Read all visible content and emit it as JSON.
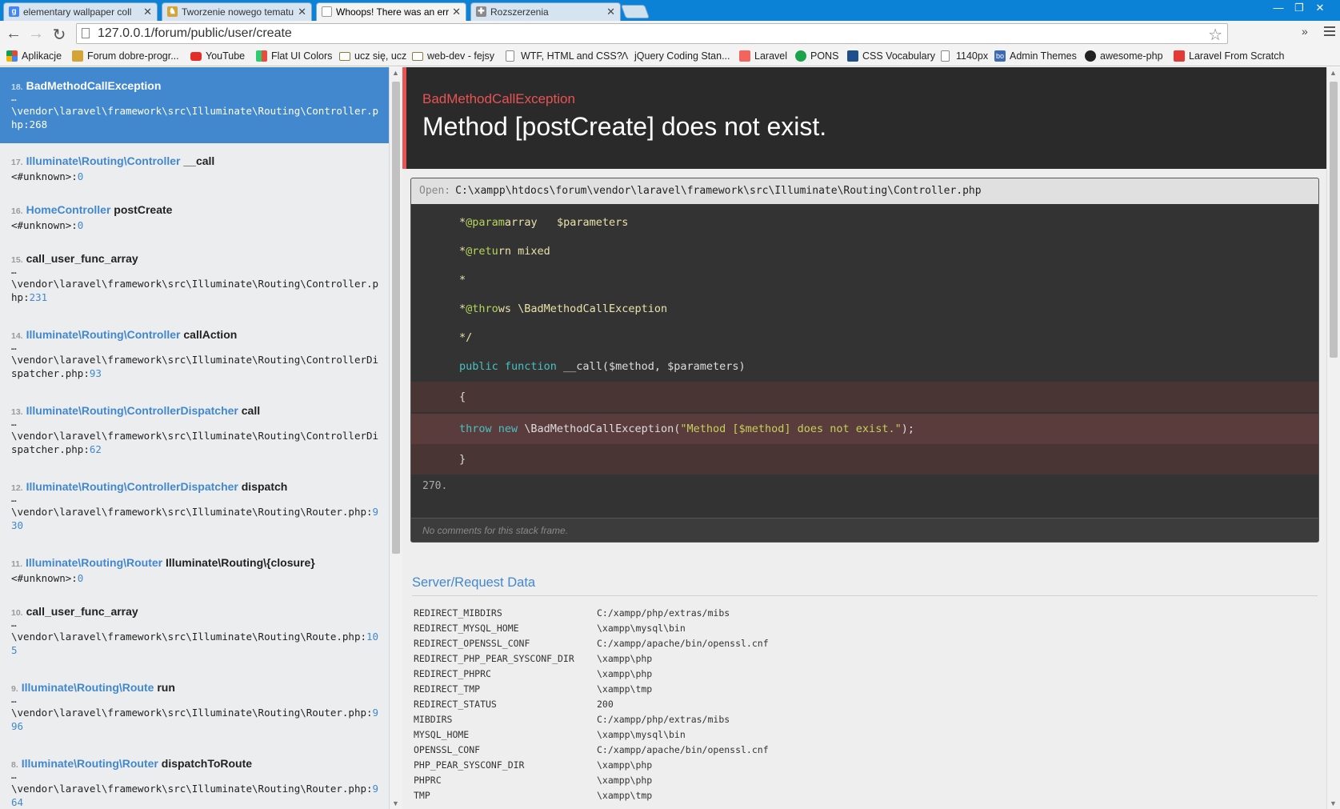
{
  "browser": {
    "tabs": [
      {
        "title": "elementary wallpaper coll",
        "active": false,
        "icon": "google-icon",
        "icon_letter": "g",
        "icon_color": "#4285f4"
      },
      {
        "title": "Tworzenie nowego tematu",
        "active": false,
        "icon": "forum-icon",
        "icon_letter": "♞",
        "icon_color": "#d4a437"
      },
      {
        "title": "Whoops! There was an err",
        "active": true,
        "icon": "page-icon",
        "icon_letter": "",
        "icon_color": "#ffffff"
      },
      {
        "title": "Rozszerzenia",
        "active": false,
        "icon": "puzzle-icon",
        "icon_letter": "✚",
        "icon_color": "#8a8a8a"
      }
    ],
    "url": "127.0.0.1/forum/public/user/create",
    "bookmarks": [
      {
        "label": "Aplikacje",
        "icon": "apps-icon",
        "color": "#e04a3a"
      },
      {
        "label": "Forum dobre-progr...",
        "icon": "forum-icon",
        "color": "#d4a437"
      },
      {
        "label": "YouTube",
        "icon": "youtube-icon",
        "color": "#e52d27"
      },
      {
        "label": "Flat UI Colors",
        "icon": "flatui-icon",
        "color": "#2ecc71"
      },
      {
        "label": "ucz się, ucz",
        "icon": "folder-icon",
        "color": "#f0c060"
      },
      {
        "label": "web-dev - fejsy",
        "icon": "folder-icon",
        "color": "#f0c060"
      },
      {
        "label": "WTF, HTML and CSS?",
        "icon": "page-icon",
        "color": "#ffffff"
      },
      {
        "label": "jQuery Coding Stan...",
        "icon": "jquery-icon",
        "color": "#444444"
      },
      {
        "label": "Laravel",
        "icon": "laravel-icon",
        "color": "#f4645f"
      },
      {
        "label": "PONS",
        "icon": "pons-icon",
        "color": "#1aa34a"
      },
      {
        "label": "CSS Vocabulary",
        "icon": "css-icon",
        "color": "#1f4e8c"
      },
      {
        "label": "1140px",
        "icon": "page-icon",
        "color": "#ffffff"
      },
      {
        "label": "Admin Themes",
        "icon": "bo-icon",
        "color": "#3d6ab4"
      },
      {
        "label": "awesome-php",
        "icon": "github-icon",
        "color": "#222222"
      },
      {
        "label": "Laravel From Scratch",
        "icon": "laracasts-icon",
        "color": "#e53935"
      }
    ]
  },
  "frames": [
    {
      "index": "18.",
      "class": "BadMethodCallException",
      "method": "",
      "dots": "…",
      "file": "\\vendor\\laravel\\framework\\src\\Illuminate\\Routing\\Controller.php",
      "line": "268",
      "active": true
    },
    {
      "index": "17.",
      "class": "Illuminate\\Routing\\Controller",
      "method": "__call",
      "dots": "",
      "file": "<#unknown>",
      "line": "0",
      "active": false
    },
    {
      "index": "16.",
      "class": "HomeController",
      "method": "postCreate",
      "dots": "",
      "file": "<#unknown>",
      "line": "0",
      "active": false
    },
    {
      "index": "15.",
      "class": "",
      "method": "call_user_func_array",
      "dots": "…",
      "file": "\\vendor\\laravel\\framework\\src\\Illuminate\\Routing\\Controller.php",
      "line": "231",
      "active": false
    },
    {
      "index": "14.",
      "class": "Illuminate\\Routing\\Controller",
      "method": "callAction",
      "dots": "…",
      "file": "\\vendor\\laravel\\framework\\src\\Illuminate\\Routing\\ControllerDispatcher.php",
      "line": "93",
      "active": false
    },
    {
      "index": "13.",
      "class": "Illuminate\\Routing\\ControllerDispatcher",
      "method": "call",
      "dots": "…",
      "file": "\\vendor\\laravel\\framework\\src\\Illuminate\\Routing\\ControllerDispatcher.php",
      "line": "62",
      "active": false
    },
    {
      "index": "12.",
      "class": "Illuminate\\Routing\\ControllerDispatcher",
      "method": "dispatch",
      "dots": "…",
      "file": "\\vendor\\laravel\\framework\\src\\Illuminate\\Routing\\Router.php",
      "line": "930",
      "active": false
    },
    {
      "index": "11.",
      "class": "Illuminate\\Routing\\Router",
      "method": "Illuminate\\Routing\\{closure}",
      "dots": "",
      "file": "<#unknown>",
      "line": "0",
      "active": false
    },
    {
      "index": "10.",
      "class": "",
      "method": "call_user_func_array",
      "dots": "…",
      "file": "\\vendor\\laravel\\framework\\src\\Illuminate\\Routing\\Route.php",
      "line": "105",
      "active": false
    },
    {
      "index": "9.",
      "class": "Illuminate\\Routing\\Route",
      "method": "run",
      "dots": "…",
      "file": "\\vendor\\laravel\\framework\\src\\Illuminate\\Routing\\Router.php",
      "line": "996",
      "active": false
    },
    {
      "index": "8.",
      "class": "Illuminate\\Routing\\Router",
      "method": "dispatchToRoute",
      "dots": "…",
      "file": "\\vendor\\laravel\\framework\\src\\Illuminate\\Routing\\Router.php",
      "line": "964",
      "active": false
    }
  ],
  "exception": {
    "class": "BadMethodCallException",
    "message": "Method [postCreate] does not exist."
  },
  "code": {
    "open_label": "Open:",
    "path": "C:\\xampp\\htdocs\\forum\\vendor\\laravel\\framework\\src\\Illuminate\\Routing\\Controller.php",
    "line_number": "270.",
    "comments": "No comments for this stack frame."
  },
  "server_data": {
    "title": "Server/Request Data",
    "rows": [
      {
        "key": "REDIRECT_MIBDIRS",
        "value": "C:/xampp/php/extras/mibs"
      },
      {
        "key": "REDIRECT_MYSQL_HOME",
        "value": "\\xampp\\mysql\\bin"
      },
      {
        "key": "REDIRECT_OPENSSL_CONF",
        "value": "C:/xampp/apache/bin/openssl.cnf"
      },
      {
        "key": "REDIRECT_PHP_PEAR_SYSCONF_DIR",
        "value": "\\xampp\\php"
      },
      {
        "key": "REDIRECT_PHPRC",
        "value": "\\xampp\\php"
      },
      {
        "key": "REDIRECT_TMP",
        "value": "\\xampp\\tmp"
      },
      {
        "key": "REDIRECT_STATUS",
        "value": "200"
      },
      {
        "key": "MIBDIRS",
        "value": "C:/xampp/php/extras/mibs"
      },
      {
        "key": "MYSQL_HOME",
        "value": "\\xampp\\mysql\\bin"
      },
      {
        "key": "OPENSSL_CONF",
        "value": "C:/xampp/apache/bin/openssl.cnf"
      },
      {
        "key": "PHP_PEAR_SYSCONF_DIR",
        "value": "\\xampp\\php"
      },
      {
        "key": "PHPRC",
        "value": "\\xampp\\php"
      },
      {
        "key": "TMP",
        "value": "\\xampp\\tmp"
      }
    ]
  }
}
